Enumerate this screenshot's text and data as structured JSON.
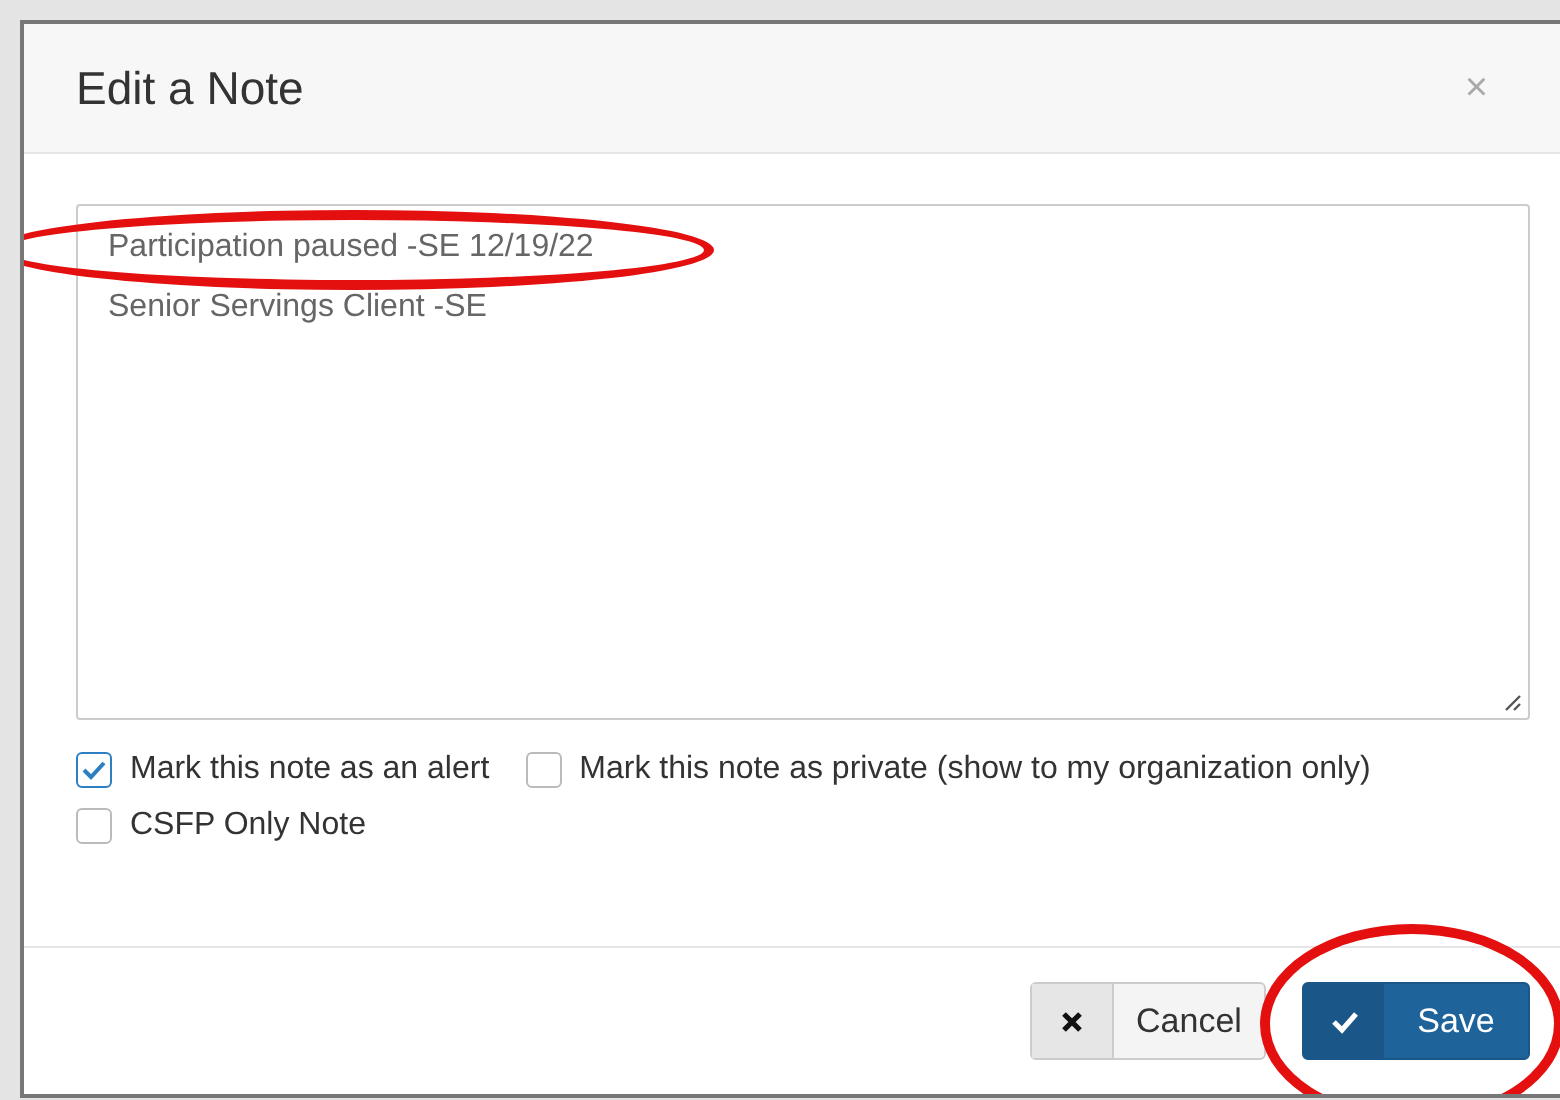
{
  "dialog": {
    "title": "Edit a Note",
    "close": "×"
  },
  "note": {
    "value": "Participation paused -SE 12/19/22\nSenior Servings Client -SE"
  },
  "options": [
    {
      "label": "Mark this note as an alert",
      "checked": true
    },
    {
      "label": "Mark this note as private (show to my organization only)",
      "checked": false
    },
    {
      "label": "CSFP Only Note",
      "checked": false
    }
  ],
  "buttons": [
    {
      "kind": "cancel",
      "label": "Cancel"
    },
    {
      "kind": "save",
      "label": "Save"
    }
  ]
}
